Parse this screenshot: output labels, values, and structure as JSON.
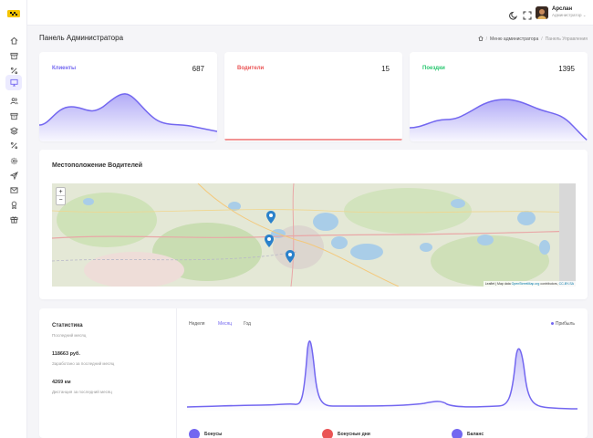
{
  "header": {
    "user_name": "Арслан",
    "user_role": "Администратор ⌄"
  },
  "page": {
    "title": "Панель Администратора",
    "breadcrumb": [
      "Меню администратора",
      "Панель Управления"
    ]
  },
  "stats": [
    {
      "label": "Клиенты",
      "value": "687",
      "color": "#7367f0"
    },
    {
      "label": "Водители",
      "value": "15",
      "color": "#ea5455"
    },
    {
      "label": "Поездки",
      "value": "1395",
      "color": "#28c76f"
    }
  ],
  "map": {
    "title": "Местоположение Водителей",
    "zoom_in": "+",
    "zoom_out": "−",
    "attribution_prefix": "Leaflet | Map data ",
    "attribution_link": "OpenStreetMap.org",
    "attribution_suffix": " contributors, ",
    "attribution_license": "CC-BY-SA"
  },
  "statistics": {
    "title": "Статистика",
    "subtitle": "Последний месяц",
    "earned_value": "118663 руб.",
    "earned_caption": "Заработано за последний месяц",
    "distance_value": "4269 км",
    "distance_caption": "Дистанция за последний месяц",
    "tabs": [
      "Неделя",
      "Месяц",
      "Год"
    ],
    "active_tab": "Месяц",
    "export_label": "Прибыль",
    "legend": [
      {
        "label": "Бонусы",
        "color": "#7367f0"
      },
      {
        "label": "Бонусные дни",
        "color": "#ea5455"
      },
      {
        "label": "Баланс",
        "color": "#7367f0"
      }
    ]
  },
  "colors": {
    "accent": "#7367f0",
    "danger": "#ea5455",
    "success": "#28c76f"
  },
  "icons": {
    "sidebar": [
      "home-icon",
      "archive-icon",
      "percent-icon",
      "monitor-icon",
      "users-icon",
      "archive-icon",
      "layers-icon",
      "percent-icon",
      "settings-icon",
      "send-icon",
      "mail-icon",
      "award-icon",
      "gift-icon"
    ],
    "topbar": [
      "moon-icon",
      "maximize-icon"
    ]
  }
}
